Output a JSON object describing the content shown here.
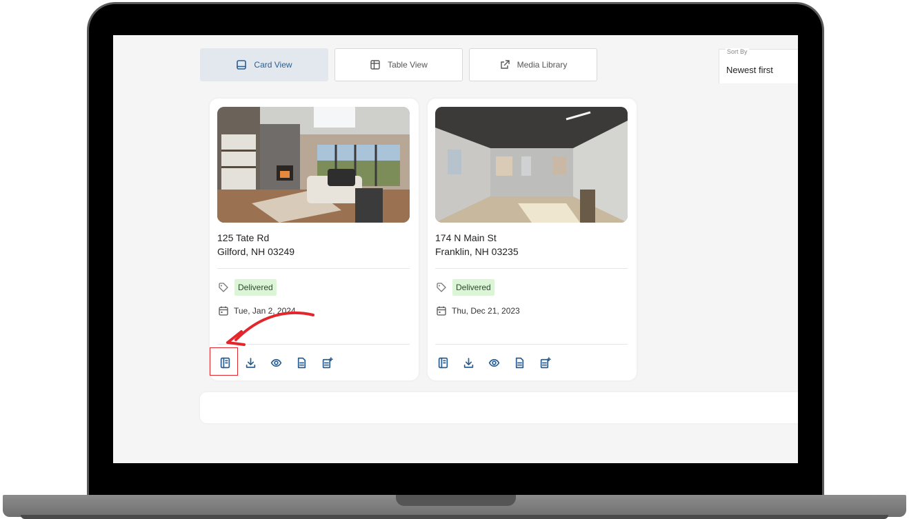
{
  "view_tabs": [
    {
      "label": "Card View",
      "icon": "card-view-icon",
      "active": true
    },
    {
      "label": "Table View",
      "icon": "table-icon",
      "active": false
    },
    {
      "label": "Media Library",
      "icon": "external-link-icon",
      "active": false
    }
  ],
  "sort": {
    "label": "Sort By",
    "value": "Newest first"
  },
  "listings": [
    {
      "address_line1": "125 Tate Rd",
      "address_line2": "Gilford, NH 03249",
      "status": "Delivered",
      "date": "Tue, Jan 2, 2024",
      "actions": [
        "property-website-icon",
        "download-icon",
        "view-icon",
        "document-icon",
        "add-document-icon"
      ]
    },
    {
      "address_line1": "174 N Main St",
      "address_line2": "Franklin, NH 03235",
      "status": "Delivered",
      "date": "Thu, Dec 21, 2023",
      "actions": [
        "property-website-icon",
        "download-icon",
        "view-icon",
        "document-icon",
        "add-document-icon"
      ]
    }
  ],
  "colors": {
    "accent": "#2a5d8f",
    "status_bg": "#dcf5d6",
    "annotation": "#e2262b",
    "active_tab_bg": "#e3e8ef"
  }
}
